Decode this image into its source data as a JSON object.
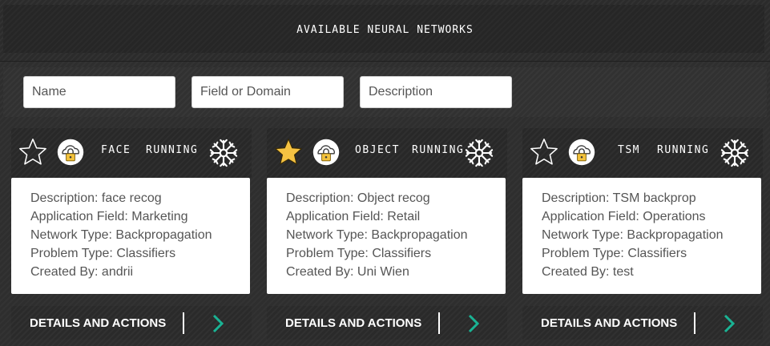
{
  "header": {
    "title": "AVAILABLE NEURAL NETWORKS"
  },
  "filters": {
    "name_placeholder": "Name",
    "field_placeholder": "Field or Domain",
    "description_placeholder": "Description"
  },
  "colors": {
    "accent_teal": "#1ab394",
    "star_gold": "#f5c242",
    "card_body": "#ffffff"
  },
  "cards": [
    {
      "name": "FACE",
      "status": "RUNNING",
      "favorite": false,
      "description": "Description: face recog",
      "application_field": "Application Field: Marketing",
      "network_type": "Network Type: Backpropagation",
      "problem_type": "Problem Type: Classifiers",
      "created_by": "Created By: andrii",
      "action_label": "DETAILS AND ACTIONS"
    },
    {
      "name": "OBJECT",
      "status": "RUNNING",
      "favorite": true,
      "description": "Description: Object recog",
      "application_field": "Application Field: Retail",
      "network_type": "Network Type: Backpropagation",
      "problem_type": "Problem Type: Classifiers",
      "created_by": "Created By: Uni Wien",
      "action_label": "DETAILS AND ACTIONS"
    },
    {
      "name": "TSM",
      "status": "RUNNING",
      "favorite": false,
      "description": "Description: TSM backprop",
      "application_field": "Application Field: Operations",
      "network_type": "Network Type: Backpropagation",
      "problem_type": "Problem Type: Classifiers",
      "created_by": "Created By: test",
      "action_label": "DETAILS AND ACTIONS"
    }
  ],
  "icons": {
    "favorite": "star-icon",
    "access": "cloud-lock-icon",
    "network": "neural-network-icon",
    "action": "chevron-right-icon"
  }
}
